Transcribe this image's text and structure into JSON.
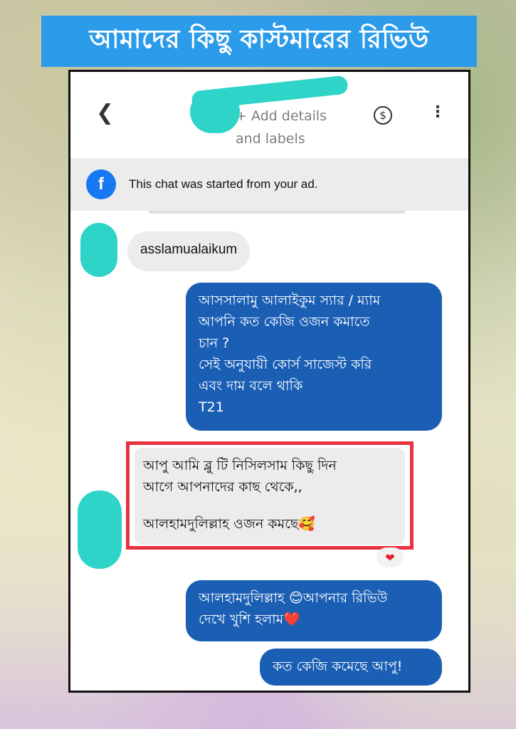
{
  "banner": {
    "title": "আমাদের কিছু কাস্টমারের রিভিউ"
  },
  "header": {
    "back_icon": "chevron-left-icon",
    "add_details_line1": "+ Add details",
    "add_details_line2": "and labels",
    "dollar_icon": "dollar-icon",
    "more_icon": "more-vertical-icon"
  },
  "ad_banner": {
    "icon": "facebook-icon",
    "text": "This chat was started from your ad."
  },
  "messages": [
    {
      "side": "incoming",
      "lines": [
        "asslamualaikum"
      ]
    },
    {
      "side": "outgoing",
      "lines": [
        "আসসালামু আলাইকুম স্যার / ম্যাম",
        "আপনি কত কেজি ওজন কমাতে",
        "চান ?",
        "সেই অনুযায়ী কোর্স সাজেস্ট করি",
        "এবং দাম বলে থাকি",
        "T21"
      ]
    },
    {
      "side": "incoming",
      "lines": [
        "আপু আমি ব্লু টি নিসিলসাম কিছু দিন",
        "আগে আপনাদের কাছ থেকে,,",
        "",
        "আলহামদুলিল্লাহ ওজন কমছে🥰"
      ]
    },
    {
      "side": "outgoing",
      "lines": [
        "আলহামদুলিল্লাহ 😊আপনার রিভিউ",
        "দেখে খুশি হলাম❤️"
      ]
    },
    {
      "side": "outgoing",
      "lines": [
        "কত কেজি কমেছে আপু!"
      ]
    }
  ],
  "reaction": "❤",
  "colors": {
    "banner": "#2c9bea",
    "outgoing_bubble": "#1b5fb5",
    "incoming_bubble": "#ececec",
    "highlight_box": "#e8323f",
    "redaction": "#2fd4c8"
  }
}
